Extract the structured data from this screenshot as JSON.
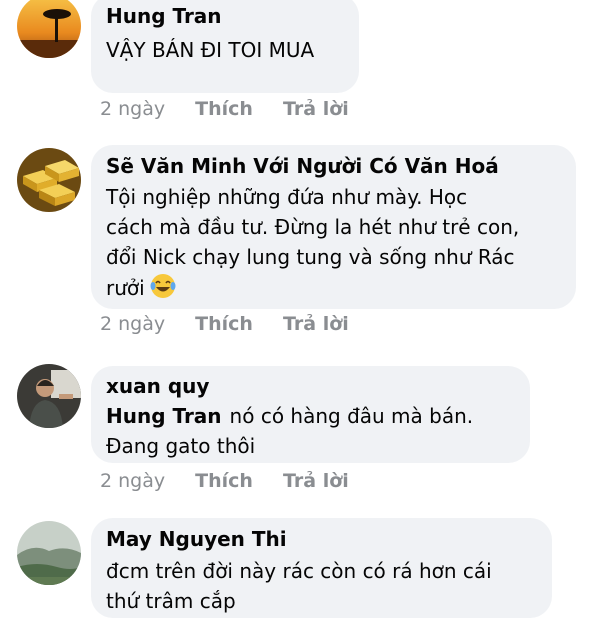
{
  "comments": [
    {
      "author": "Hung Tran",
      "text": "VẬY BÁN ĐI TOI MUA",
      "time": "2 ngày",
      "like": "Thích",
      "reply": "Trả lời",
      "avatar_icon": "sunset-tree-avatar"
    },
    {
      "author": "Sẽ Văn Minh Với Người Có Văn Hoá",
      "text_lines": [
        "Tội nghiệp những đứa như mày. Học",
        "cách mà đầu tư. Đừng la hét như trẻ con,",
        "đổi Nick chạy lung tung và sống như Rác",
        "rưởi"
      ],
      "emoji_icon": "laughing-tears-emoji",
      "time": "2 ngày",
      "like": "Thích",
      "reply": "Trả lời",
      "avatar_icon": "gold-bars-avatar"
    },
    {
      "author": "xuan quy",
      "mention": "Hung Tran",
      "text_first": "nó có hàng đâu mà bán.",
      "text_second": "Đang gato thôi",
      "time": "2 ngày",
      "like": "Thích",
      "reply": "Trả lời",
      "avatar_icon": "person-photo-avatar"
    },
    {
      "author": "May Nguyen Thi",
      "text_lines": [
        "đcm trên đời này rác còn có rá hơn cái",
        "thứ trâm cắp"
      ],
      "avatar_icon": "landscape-avatar"
    }
  ],
  "colors": {
    "bubble": "#f0f2f5",
    "text": "#050505",
    "meta": "#8a8d91"
  }
}
